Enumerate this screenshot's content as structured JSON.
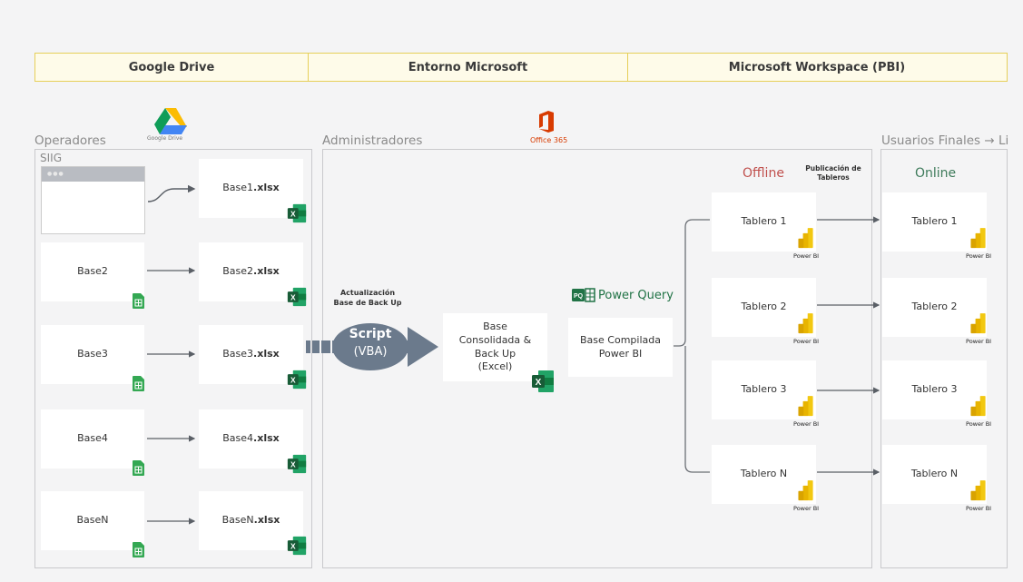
{
  "header": {
    "col1": "Google Drive",
    "col2": "Entorno Microsoft",
    "col3": "Microsoft Workspace (PBI)"
  },
  "sections": {
    "operadores": "Operadores",
    "administradores": "Administradores",
    "usuarios": "Usuarios Finales → Li",
    "siig": "SIIG"
  },
  "logos": {
    "google_drive": "Google Drive",
    "office365": "Office 365",
    "power_query": "Power Query",
    "pq_badge": "PQ",
    "power_bi": "Power BI"
  },
  "sources": [
    {
      "name": "",
      "file": "Base1",
      "ext": ".xlsx"
    },
    {
      "name": "Base2",
      "file": "Base2",
      "ext": ".xlsx"
    },
    {
      "name": "Base3",
      "file": "Base3",
      "ext": ".xlsx"
    },
    {
      "name": "Base4",
      "file": "Base4",
      "ext": ".xlsx"
    },
    {
      "name": "BaseN",
      "file": "BaseN",
      "ext": ".xlsx"
    }
  ],
  "script": {
    "note_line1": "Actualización",
    "note_line2": "Base de Back Up",
    "title": "Script",
    "subtitle": "(VBA)"
  },
  "consolidated": {
    "line1": "Base",
    "line2": "Consolidada &",
    "line3": "Back Up",
    "line4": "(Excel)"
  },
  "compiled": {
    "line1": "Base Compilada",
    "line2": "Power BI"
  },
  "offline": {
    "label": "Offline",
    "publish_line1": "Publicación de",
    "publish_line2": "Tableros",
    "boards": [
      "Tablero 1",
      "Tablero 2",
      "Tablero 3",
      "Tablero N"
    ]
  },
  "online": {
    "label": "Online",
    "boards": [
      "Tablero 1",
      "Tablero 2",
      "Tablero 3",
      "Tablero N"
    ]
  },
  "colors": {
    "offline": "#c0504d",
    "online": "#3d7a5a",
    "excel": "#1f7a45",
    "sheets": "#34a853",
    "office": "#d83b01",
    "pbi": "#f2c811",
    "header_border": "#e6cf5a",
    "script_arrow": "#6b7a8c"
  }
}
